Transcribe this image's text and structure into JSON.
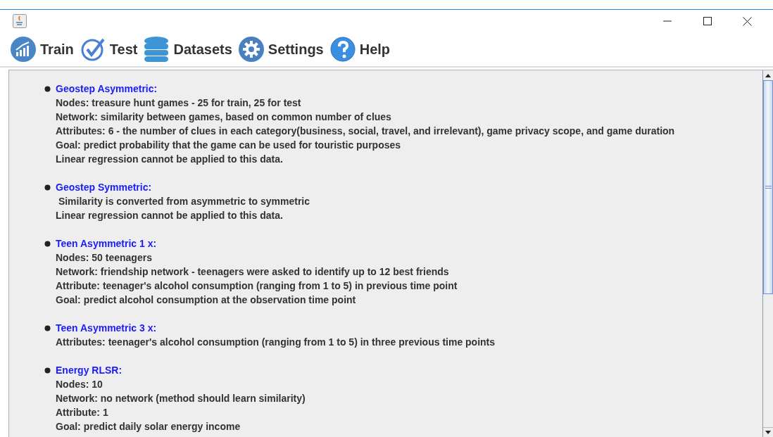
{
  "toolbar": [
    {
      "kind": "train",
      "label": "Train"
    },
    {
      "kind": "test",
      "label": "Test"
    },
    {
      "kind": "datasets",
      "label": "Datasets"
    },
    {
      "kind": "settings",
      "label": "Settings"
    },
    {
      "kind": "help",
      "label": "Help"
    }
  ],
  "datasets": [
    {
      "title": "Geostep Asymmetric:",
      "lines": [
        "Nodes: treasure hunt games - 25 for train, 25 for test",
        "Network: similarity between games, based on common number of clues",
        "Attributes: 6 - the number of clues in each category(business, social, travel, and irrelevant), game privacy scope, and game duration",
        "Goal: predict probability that the game can be used for touristic purposes",
        "Linear regression cannot be applied to this data."
      ]
    },
    {
      "title": "Geostep Symmetric:",
      "lines": [
        " Similarity is converted from asymmetric to symmetric",
        "Linear regression cannot be applied to this data."
      ]
    },
    {
      "title": "Teen Asymmetric 1 x:",
      "lines": [
        "Nodes: 50 teenagers",
        "Network: friendship network - teenagers were asked to identify up to 12 best friends",
        "Attribute: teenager's alcohol consumption (ranging from 1 to 5) in previous time point",
        "Goal: predict alcohol consumption at the observation time point"
      ]
    },
    {
      "title": "Teen Asymmetric 3 x:",
      "lines": [
        "Attributes: teenager's alcohol consumption (ranging from 1 to 5) in three previous time points"
      ]
    },
    {
      "title": "Energy RLSR:",
      "lines": [
        "Nodes: 10",
        "Network: no network (method should learn similarity)",
        "Attribute: 1",
        "Goal: predict daily solar energy income"
      ]
    }
  ]
}
